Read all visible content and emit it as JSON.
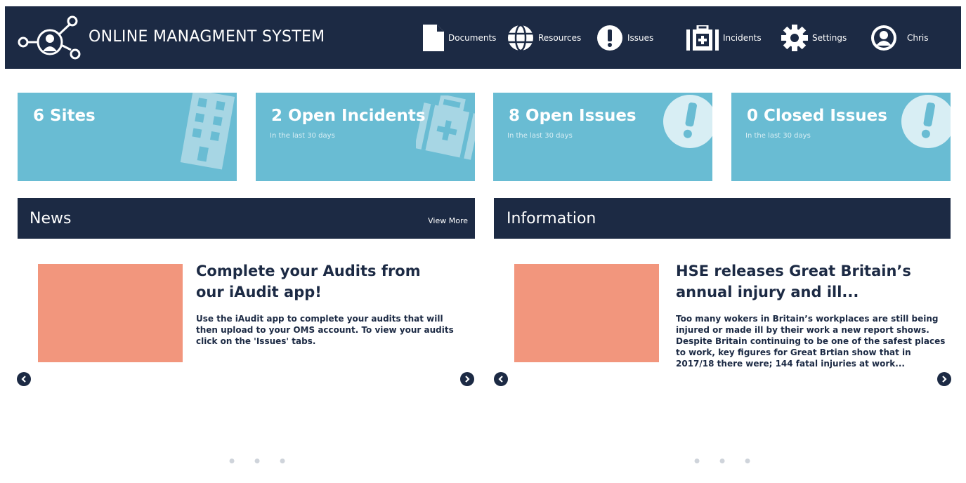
{
  "header": {
    "title": "ONLINE MANAGMENT SYSTEM",
    "nav": [
      {
        "label": "Documents",
        "icon": "document-icon"
      },
      {
        "label": "Resources",
        "icon": "globe-icon"
      },
      {
        "label": "Issues",
        "icon": "exclamation-icon"
      },
      {
        "label": "Incidents",
        "icon": "first-aid-kit-icon"
      },
      {
        "label": "Settings",
        "icon": "gear-icon"
      },
      {
        "label": "Chris",
        "icon": "user-avatar-icon"
      }
    ]
  },
  "cards": [
    {
      "title": "6 Sites",
      "subtitle": "",
      "icon": "building-icon"
    },
    {
      "title": "2 Open Incidents",
      "subtitle": "In the last 30 days",
      "icon": "first-aid-kit-icon"
    },
    {
      "title": "8 Open Issues",
      "subtitle": "In the last 30 days",
      "icon": "exclamation-icon"
    },
    {
      "title": "0 Closed Issues",
      "subtitle": "In the last 30 days",
      "icon": "exclamation-icon"
    }
  ],
  "news": {
    "title": "News",
    "view_more": "View More",
    "article": {
      "title_line1": "Complete your Audits from",
      "title_line2": "our iAudit app!",
      "body_lines": [
        "Use the iAudit app to complete your audits that will",
        "then upload to your OMS account. To view your audits",
        "click on the 'Issues' tabs."
      ]
    }
  },
  "information": {
    "title": "Information",
    "article": {
      "title_line1": "HSE releases Great Britain’s",
      "title_line2": "annual injury and ill...",
      "body_lines": [
        "Too many wokers in Britain’s workplaces are still being",
        "injured or made ill by their work a new report shows.",
        "Despite Britain continuing to be one of the safest places",
        "to work, key figures for Great Brtian show that in",
        "2017/18 there were; 144 fatal injuries at work..."
      ]
    }
  },
  "colors": {
    "navy": "#1c2a44",
    "card_blue": "#69bcd3",
    "thumb_salmon": "#f2967d"
  }
}
